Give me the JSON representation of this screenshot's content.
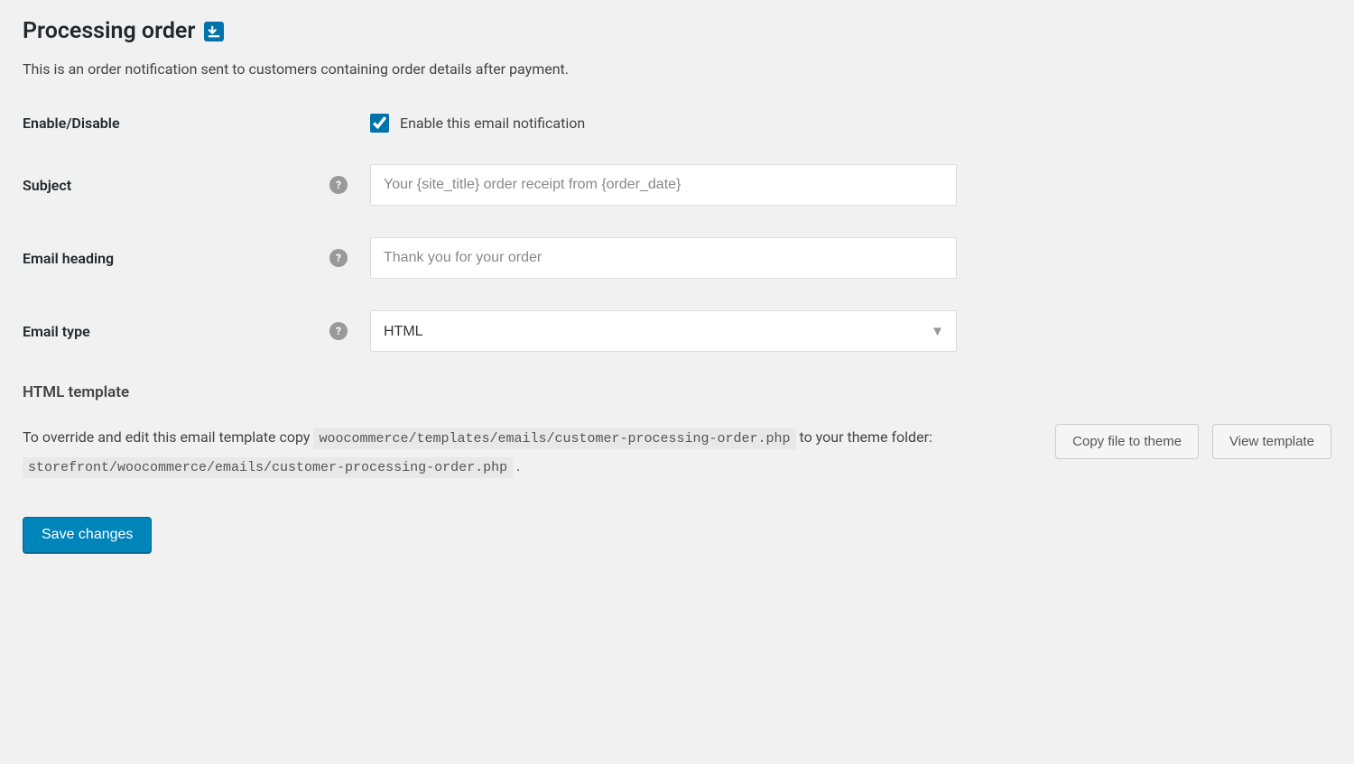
{
  "header": {
    "title": "Processing order"
  },
  "description": "This is an order notification sent to customers containing order details after payment.",
  "fields": {
    "enable": {
      "label": "Enable/Disable",
      "checkbox_label": "Enable this email notification",
      "checked": true
    },
    "subject": {
      "label": "Subject",
      "placeholder": "Your {site_title} order receipt from {order_date}",
      "value": ""
    },
    "email_heading": {
      "label": "Email heading",
      "placeholder": "Thank you for your order",
      "value": ""
    },
    "email_type": {
      "label": "Email type",
      "selected": "HTML"
    }
  },
  "template": {
    "heading": "HTML template",
    "text_before": "To override and edit this email template copy ",
    "code1": "woocommerce/templates/emails/customer-processing-order.php",
    "text_middle": " to your theme folder: ",
    "code2": "storefront/woocommerce/emails/customer-processing-order.php",
    "text_after": " .",
    "copy_button": "Copy file to theme",
    "view_button": "View template"
  },
  "actions": {
    "save": "Save changes"
  }
}
